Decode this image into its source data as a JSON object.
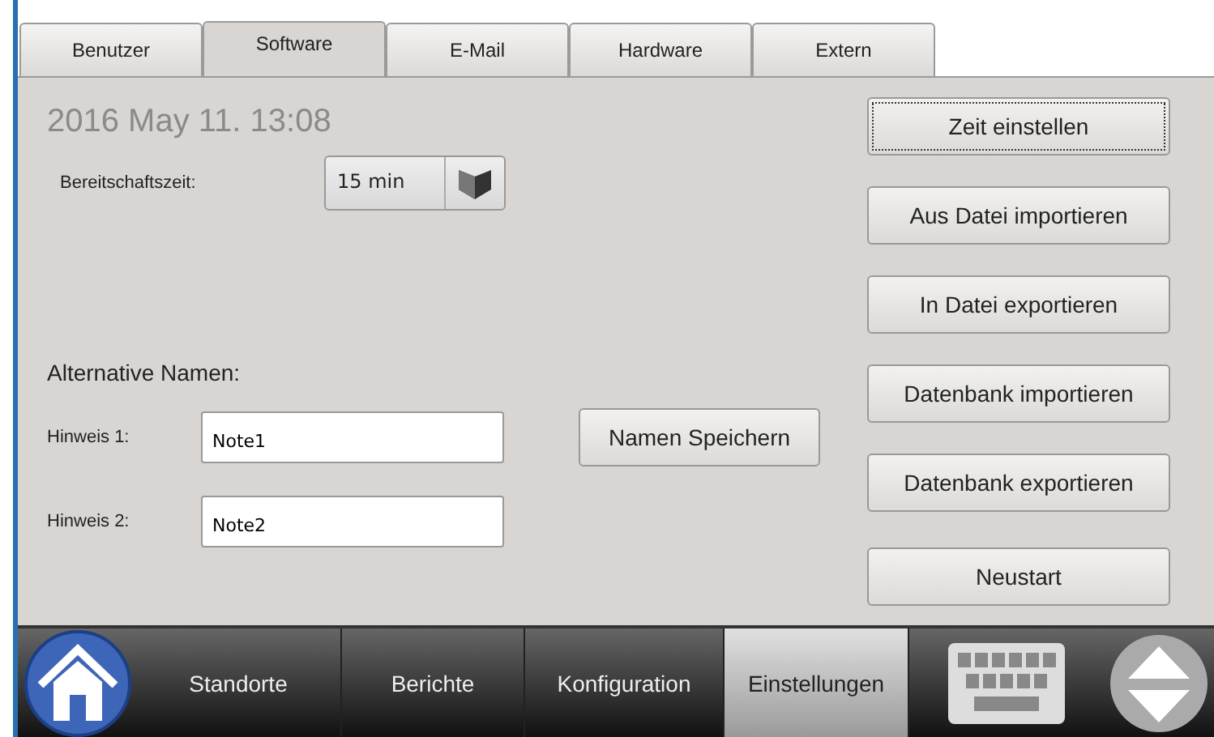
{
  "tabs": [
    {
      "label": "Benutzer",
      "selected": false
    },
    {
      "label": "Software",
      "selected": true
    },
    {
      "label": "E-Mail",
      "selected": false
    },
    {
      "label": "Hardware",
      "selected": false
    },
    {
      "label": "Extern",
      "selected": false
    }
  ],
  "datetime": "2016 May 11. 13:08",
  "standby": {
    "label": "Bereitschaftszeit:",
    "value": "15 min"
  },
  "alt_names": {
    "heading": "Alternative Namen:",
    "fields": [
      {
        "label": "Hinweis 1:",
        "value": "Note1"
      },
      {
        "label": "Hinweis 2:",
        "value": "Note2"
      }
    ],
    "save_button": "Namen Speichern"
  },
  "actions": [
    {
      "label": "Zeit einstellen",
      "focused": true
    },
    {
      "label": "Aus Datei importieren",
      "focused": false
    },
    {
      "label": "In Datei exportieren",
      "focused": false
    },
    {
      "label": "Datenbank importieren",
      "focused": false
    },
    {
      "label": "Datenbank exportieren",
      "focused": false
    },
    {
      "label": "Neustart",
      "focused": false
    }
  ],
  "nav": [
    {
      "label": "Standorte",
      "selected": false
    },
    {
      "label": "Berichte",
      "selected": false
    },
    {
      "label": "Konfiguration",
      "selected": false
    },
    {
      "label": "Einstellungen",
      "selected": true
    }
  ]
}
